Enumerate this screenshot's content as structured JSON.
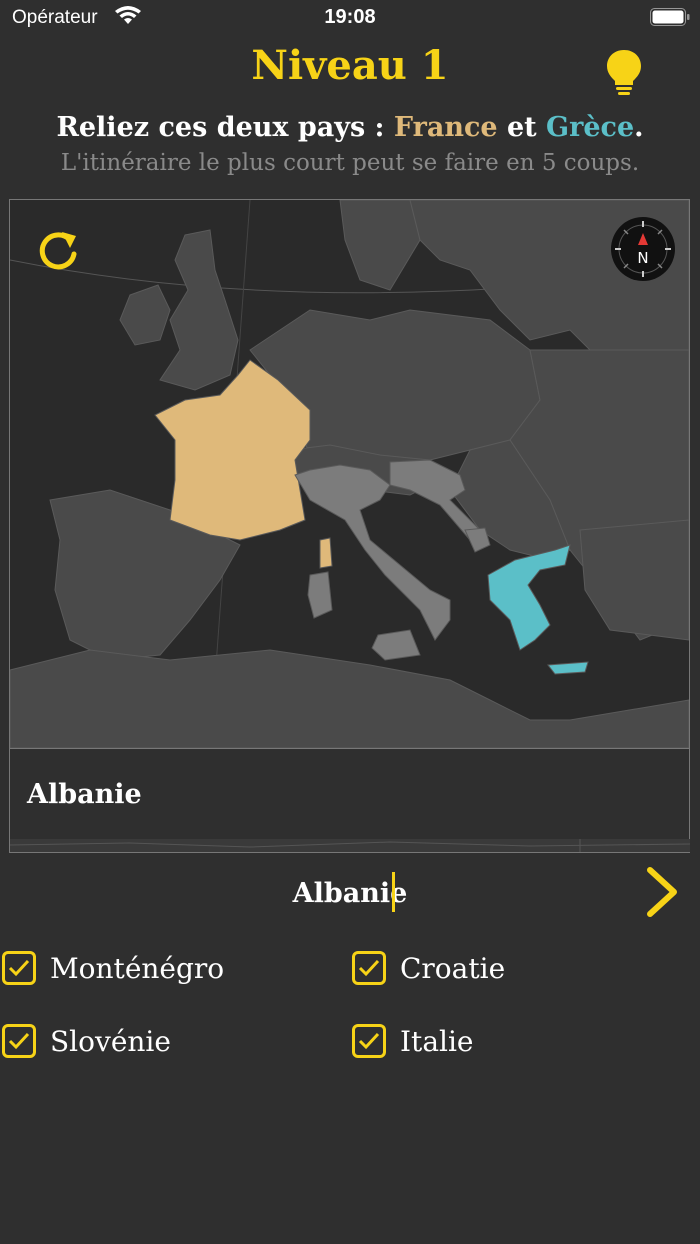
{
  "status_bar": {
    "carrier": "Opérateur",
    "time": "19:08"
  },
  "header": {
    "title": "Niveau 1"
  },
  "instruction": {
    "prefix": "Reliez ces deux pays : ",
    "start_country": "France",
    "joiner": " et ",
    "end_country": "Grèce",
    "suffix": ".",
    "subtitle": "L'itinéraire le plus court peut se faire en 5 coups."
  },
  "map": {
    "compass_label": "N",
    "colors": {
      "start": "#dfb97a",
      "end": "#5bbfc8",
      "guessed": "#7c7c7c",
      "land": "#4a4a4a",
      "sea": "#2a2a2a"
    }
  },
  "suggestion": {
    "item": "Albanie"
  },
  "input": {
    "value": "Albanie"
  },
  "guesses": [
    {
      "name": "Monténégro",
      "checked": true
    },
    {
      "name": "Croatie",
      "checked": true
    },
    {
      "name": "Slovénie",
      "checked": true
    },
    {
      "name": "Italie",
      "checked": true
    }
  ],
  "colors": {
    "accent": "#f7d317",
    "background": "#2f2f2f",
    "subtitle": "#8a8a8a"
  }
}
